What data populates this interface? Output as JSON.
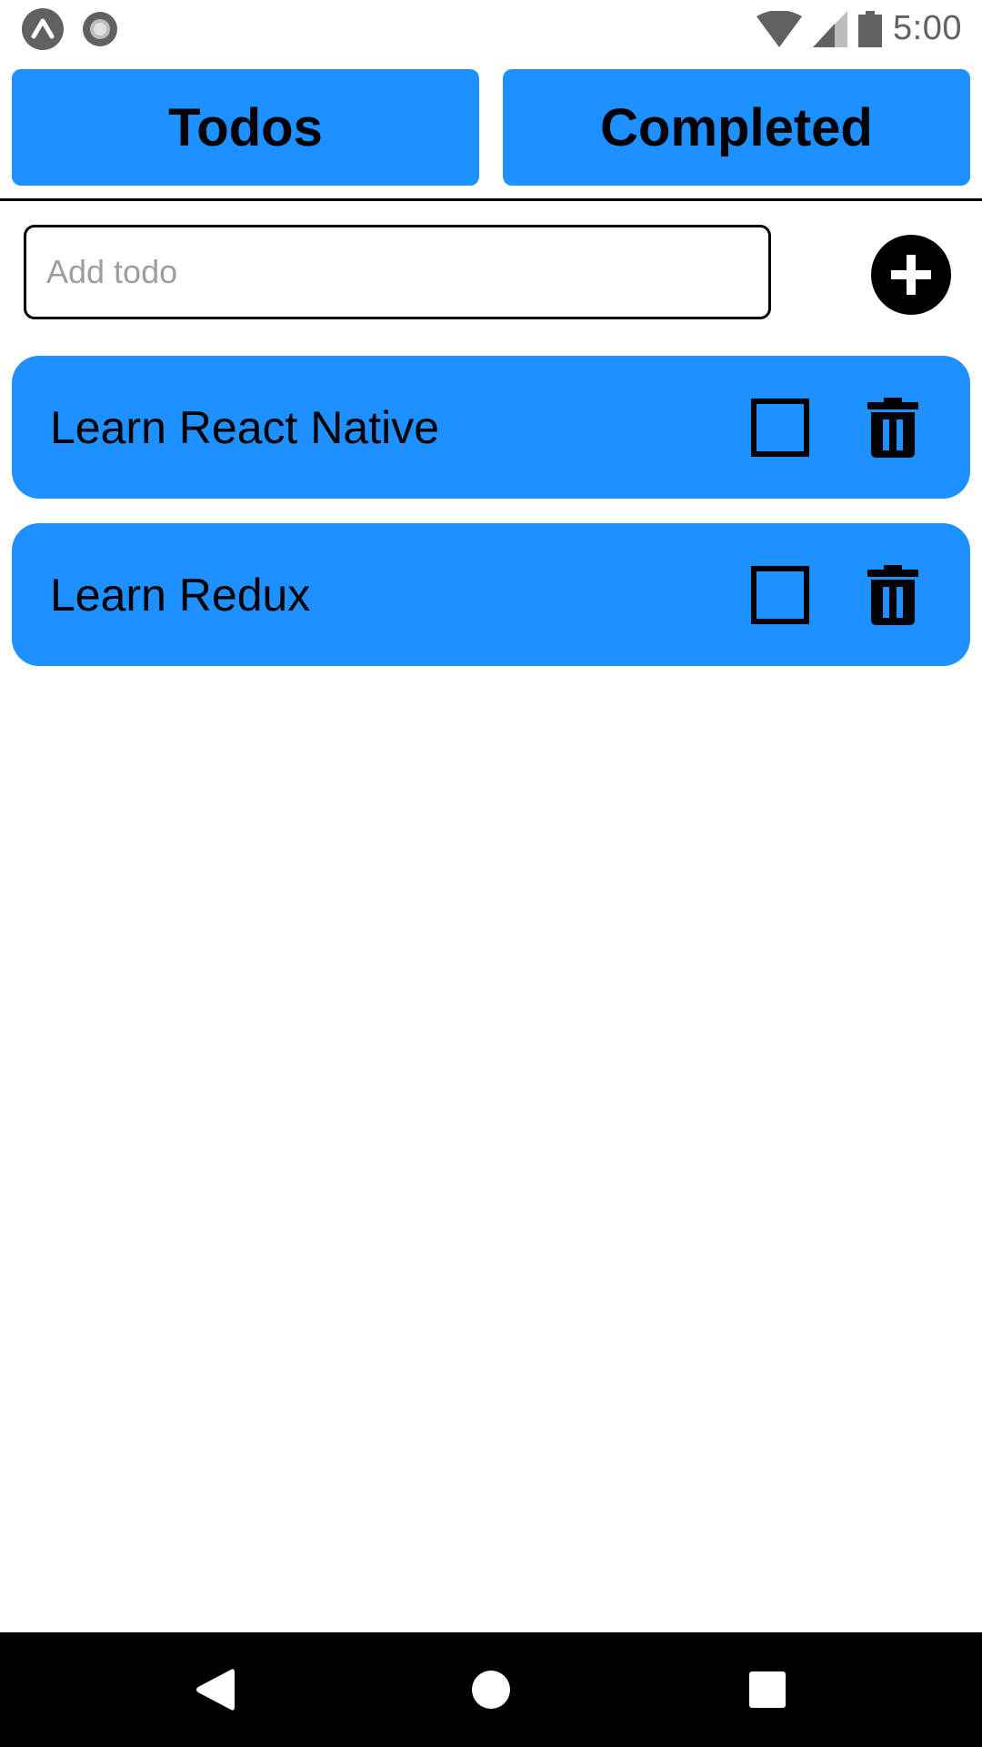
{
  "status_bar": {
    "time": "5:00",
    "left_icons": [
      "expo-icon",
      "record-icon"
    ],
    "right_icons": [
      "wifi-icon",
      "signal-icon",
      "battery-icon"
    ]
  },
  "tabs": [
    {
      "label": "Todos"
    },
    {
      "label": "Completed"
    }
  ],
  "add_todo": {
    "placeholder": "Add todo",
    "value": ""
  },
  "todos": [
    {
      "text": "Learn React Native",
      "completed": false
    },
    {
      "text": "Learn Redux",
      "completed": false
    }
  ],
  "nav_bar": {
    "buttons": [
      "back-icon",
      "home-icon",
      "recents-icon"
    ]
  },
  "colors": {
    "accent": "#1e90ff",
    "text": "#000000",
    "status_icon": "#616161",
    "nav_bar": "#000000",
    "placeholder": "#9e9e9e"
  }
}
